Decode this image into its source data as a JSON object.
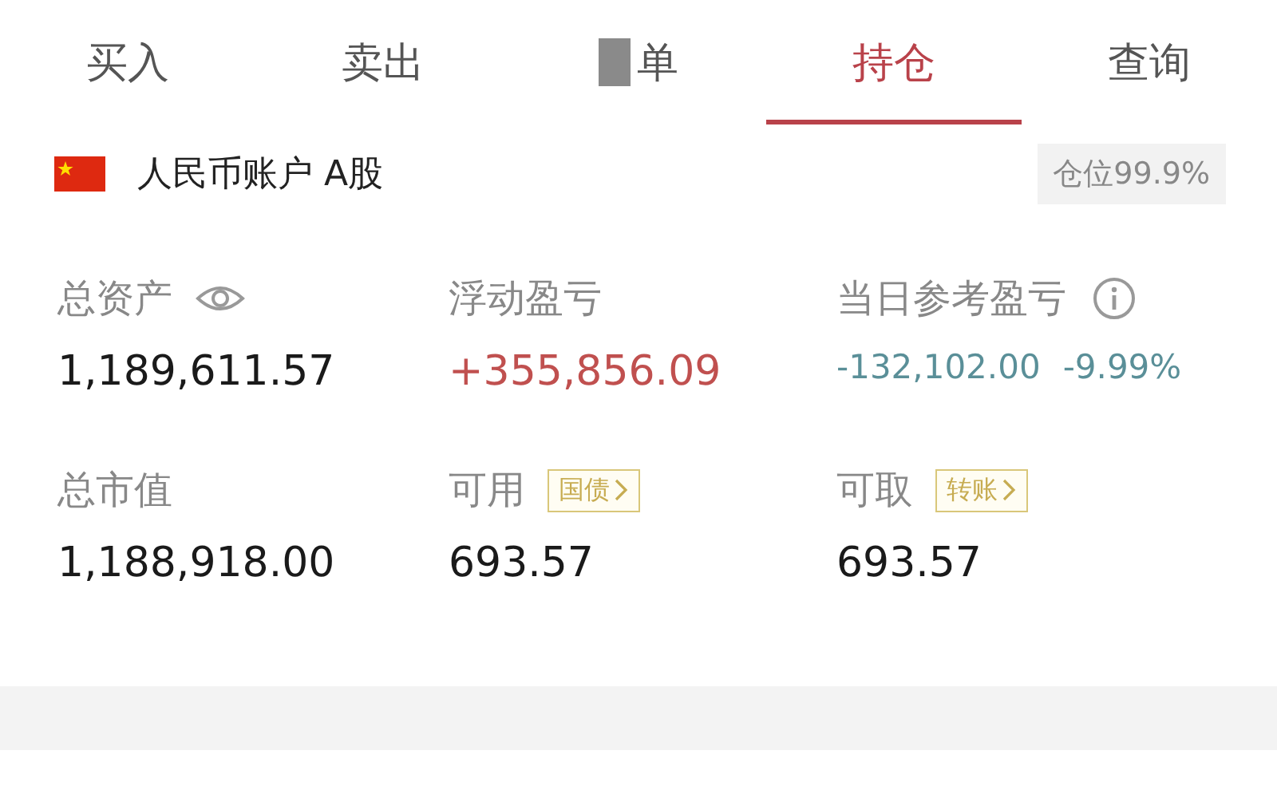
{
  "tabs": [
    {
      "label": "买入",
      "selected": false,
      "redacted": false
    },
    {
      "label": "卖出",
      "selected": false,
      "redacted": false
    },
    {
      "label": "单",
      "selected": false,
      "redacted": true
    },
    {
      "label": "持仓",
      "selected": true,
      "redacted": false
    },
    {
      "label": "查询",
      "selected": false,
      "redacted": false
    }
  ],
  "account": {
    "name": "人民币账户 A股",
    "position": "仓位99.9%"
  },
  "stats": [
    {
      "kind": "eye",
      "label": "总资产",
      "values": [
        {
          "text": "1,189,611.57",
          "color": "#1a1a1a"
        }
      ]
    },
    {
      "kind": "plain",
      "label": "浮动盈亏",
      "values": [
        {
          "text": "+355,856.09",
          "color": "#c0504f"
        }
      ]
    },
    {
      "kind": "info",
      "label": "当日参考盈亏",
      "values": [
        {
          "text": "-132,102.00",
          "color": "#5a8f98"
        },
        {
          "text": "-9.99%",
          "color": "#5a8f98"
        }
      ]
    },
    {
      "kind": "plain",
      "label": "总市值",
      "values": [
        {
          "text": "1,188,918.00",
          "color": "#1a1a1a"
        }
      ]
    },
    {
      "kind": "tag",
      "label": "可用",
      "tag": "国债",
      "values": [
        {
          "text": "693.57",
          "color": "#1a1a1a"
        }
      ]
    },
    {
      "kind": "tag",
      "label": "可取",
      "tag": "转账",
      "values": [
        {
          "text": "693.57",
          "color": "#1a1a1a"
        }
      ]
    }
  ]
}
